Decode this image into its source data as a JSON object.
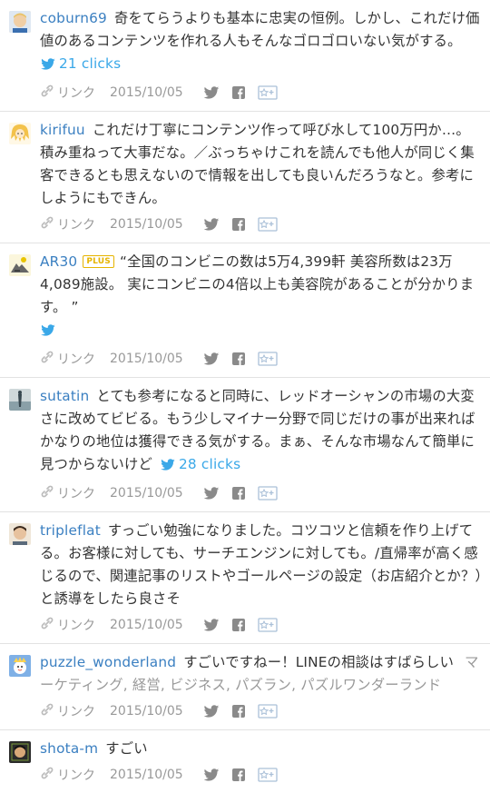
{
  "comments": [
    {
      "user": "coburn69",
      "text": "奇をてらうよりも基本に忠実の恒例。しかし、これだけ価値のあるコンテンツを作れる人もそんなゴロゴロいない気がする。",
      "clicks": "21 clicks",
      "link": "リンク",
      "date": "2015/10/05",
      "avatar_color": "#e8c9a0"
    },
    {
      "user": "kirifuu",
      "text": "これだけ丁寧にコンテンツ作って呼び水して100万円か…。積み重ねって大事だな。／ぶっちゃけこれを読んでも他人が同じく集客できるとも思えないので情報を出しても良いんだろうなと。参考にしようにもできん。",
      "link": "リンク",
      "date": "2015/10/05",
      "avatar_color": "#f4e2b0"
    },
    {
      "user": "AR30",
      "badge": "PLUS",
      "text": "“全国のコンビニの数は5万4,399軒 美容所数は23万4,089施設。 実にコンビニの4倍以上も美容院があることが分かります。 ”",
      "link": "リンク",
      "date": "2015/10/05",
      "avatar_color": "#f6f0d0"
    },
    {
      "user": "sutatin",
      "text": "とても参考になると同時に、レッドオーシャンの市場の大変さに改めてビビる。もう少しマイナー分野で同じだけの事が出来ればかなりの地位は獲得できる気がする。まぁ、そんな市場なんて簡単に見つからないけど",
      "clicks": "28 clicks",
      "link": "リンク",
      "date": "2015/10/05",
      "avatar_color": "#9fb3b8"
    },
    {
      "user": "tripleflat",
      "text": "すっごい勉強になりました。コツコツと信頼を作り上げてる。お客様に対しても、サーチエンジンに対しても。/直帰率が高く感じるので、関連記事のリストやゴールページの設定（お店紹介とか？）と誘導をしたら良さそ",
      "link": "リンク",
      "date": "2015/10/05",
      "avatar_color": "#d8b89a"
    },
    {
      "user": "puzzle_wonderland",
      "text": "すごいですねー！LINEの相談はすばらしい",
      "tags": "マーケティング, 経営, ビジネス, パズラン, パズルワンダーランド",
      "link": "リンク",
      "date": "2015/10/05",
      "avatar_color": "#a9c4e6"
    },
    {
      "user": "shota-m",
      "text": "すごい",
      "link": "リンク",
      "date": "2015/10/05",
      "avatar_color": "#4a4a4a"
    }
  ],
  "colors": {
    "username": "#3a7fc1",
    "clicks": "#3aa8e8",
    "meta": "#999999",
    "plus": "#e6b400"
  }
}
